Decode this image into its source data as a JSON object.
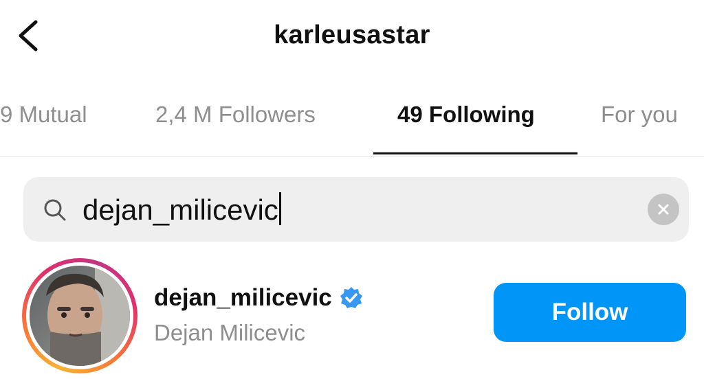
{
  "header": {
    "title": "karleusastar",
    "back_icon": "chevron-left-icon"
  },
  "tabs": [
    {
      "label": "9 Mutual",
      "active": false
    },
    {
      "label": "2,4 M Followers",
      "active": false
    },
    {
      "label": "49 Following",
      "active": true
    },
    {
      "label": "For you",
      "active": false
    }
  ],
  "search": {
    "value": "dejan_milicevic",
    "icon": "search-icon",
    "clear_icon": "clear-icon"
  },
  "results": [
    {
      "username": "dejan_milicevic",
      "full_name": "Dejan Milicevic",
      "verified": true,
      "button_label": "Follow"
    }
  ],
  "colors": {
    "accent": "#0095f6",
    "muted_text": "#8e8e8e",
    "search_bg": "#efefef",
    "verified": "#3897f0"
  }
}
